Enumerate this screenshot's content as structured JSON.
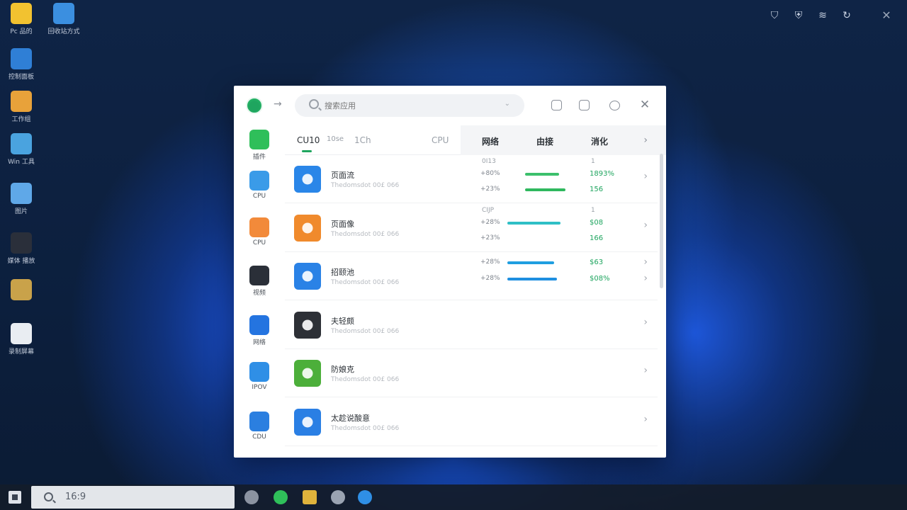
{
  "desktop": {
    "icons": [
      {
        "label": "Pc 品的",
        "color": "#f2c230"
      },
      {
        "label": "回收站方式",
        "color": "#3b8fe0"
      },
      {
        "label": "控制面板",
        "color": "#2f7fd6"
      },
      {
        "label": "工作组",
        "color": "#e8a23a"
      },
      {
        "label": "Win 工具",
        "color": "#4aa3df"
      },
      {
        "label": "图片",
        "color": "#5fa8e8"
      },
      {
        "label": "媒体 播放",
        "color": "#2a2f3a"
      },
      {
        "label": "",
        "color": "#c9a24a"
      },
      {
        "label": "录制屏幕",
        "color": "#e9edf2"
      }
    ]
  },
  "tray": [
    "shield-a",
    "shield-b",
    "wifi-signal",
    "sync"
  ],
  "window": {
    "search": {
      "placeholder": "搜索应用",
      "mic": "⌄"
    },
    "sidebar": [
      {
        "label": "插件",
        "color": "#2fbf5a",
        "icon": "tree-icon"
      },
      {
        "label": "CPU",
        "color": "#3a9be8",
        "icon": "folder-icon"
      },
      {
        "label": "CPU",
        "color": "#f28a3a",
        "icon": "spiral-icon"
      },
      {
        "label": "视频",
        "color": "#2a2f38",
        "icon": "play-icon"
      },
      {
        "label": "网络",
        "color": "#2474e0",
        "icon": "car-icon"
      },
      {
        "label": "IPOV",
        "color": "#2f8fe6",
        "icon": "list-icon"
      },
      {
        "label": "CDU",
        "color": "#2b7fe0",
        "icon": "disc-icon"
      }
    ],
    "tabs": [
      "CU10",
      "10se",
      "1Ch",
      "CPU"
    ],
    "columns": [
      "网络",
      "由接",
      "消化"
    ],
    "rows": [
      {
        "name": "页面流",
        "sub": "Thedomsdot 00£ 066",
        "color": "#2a86e8",
        "stats": [
          {
            "pct": "+80%",
            "val": "1893%",
            "bar": 0.55,
            "barColor": "#3cc06c"
          },
          {
            "pct": "+23%",
            "val": "156",
            "bar": 0.65,
            "barColor": "#2fb85e"
          }
        ],
        "head": {
          "left": "0I13",
          "right": "1"
        }
      },
      {
        "name": "页面像",
        "sub": "Thedomsdot 00£ 066",
        "color": "#f08a2c",
        "stats": [
          {
            "pct": "+28%",
            "val": "$08",
            "bar": 0.85,
            "barColor": "#2fbfc6"
          },
          {
            "pct": "+23%",
            "val": "166",
            "bar": 0,
            "barColor": "#2fb85e"
          }
        ],
        "head": {
          "left": "CIJP",
          "right": "1"
        }
      },
      {
        "name": "招颐池",
        "sub": "Thedomsdot 00£ 066",
        "color": "#2a82e6",
        "stats": [
          {
            "pct": "+28%",
            "val": "$63",
            "bar": 0.75,
            "barColor": "#1f9ee0"
          },
          {
            "pct": "+28%",
            "val": "$08%",
            "bar": 0.8,
            "barColor": "#1f8fe0"
          }
        ],
        "head": {
          "left": "",
          "right": ""
        }
      },
      {
        "name": "夫轻颇",
        "sub": "Thedomsdot 00£ 066",
        "color": "#2d3036",
        "stats": [],
        "head": {
          "left": "",
          "right": ""
        }
      },
      {
        "name": "防娘克",
        "sub": "Thedomsdot 00£ 066",
        "color": "#4caf3a",
        "stats": [],
        "head": {
          "left": "",
          "right": ""
        }
      },
      {
        "name": "太趁说酸意",
        "sub": "Thedomsdot 00£ 066",
        "color": "#2a7fe4",
        "stats": [],
        "head": {
          "left": "",
          "right": ""
        }
      }
    ]
  },
  "taskbar": {
    "search_text": "16:9",
    "apps": [
      {
        "name": "settings",
        "color": "#8b93a1"
      },
      {
        "name": "wechat",
        "color": "#2fbf5a"
      },
      {
        "name": "photos",
        "color": "#e0b33c"
      },
      {
        "name": "clock",
        "color": "#9aa3b2"
      },
      {
        "name": "browser",
        "color": "#2f8fe6"
      }
    ]
  }
}
